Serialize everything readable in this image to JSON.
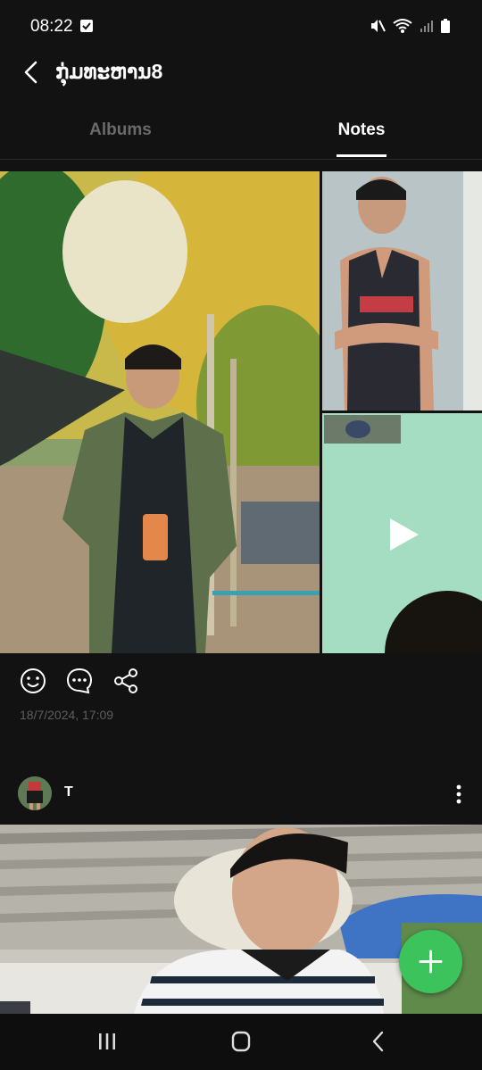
{
  "status_bar": {
    "time": "08:22",
    "icons": [
      "checkbox-notification-icon",
      "mute-icon",
      "wifi-icon",
      "signal-icon",
      "battery-icon"
    ]
  },
  "header": {
    "title": "ກຸ່ມທະຫານ8",
    "back_icon": "chevron-left-icon"
  },
  "tabs": [
    {
      "label": "Albums",
      "active": false
    },
    {
      "label": "Notes",
      "active": true
    }
  ],
  "post": {
    "actions": [
      "smiley-icon",
      "comment-icon",
      "share-icon"
    ],
    "timestamp": "18/7/2024, 17:09"
  },
  "next_post": {
    "author": "T",
    "more_icon": "more-vertical-icon"
  },
  "fab": {
    "icon": "plus-icon",
    "color": "#3CC35B"
  },
  "nav_bar": {
    "buttons": [
      "recent-apps-icon",
      "home-icon",
      "back-icon"
    ]
  },
  "colors": {
    "background": "#121212",
    "accent": "#3CC35B",
    "muted_text": "#6A6A6A"
  }
}
